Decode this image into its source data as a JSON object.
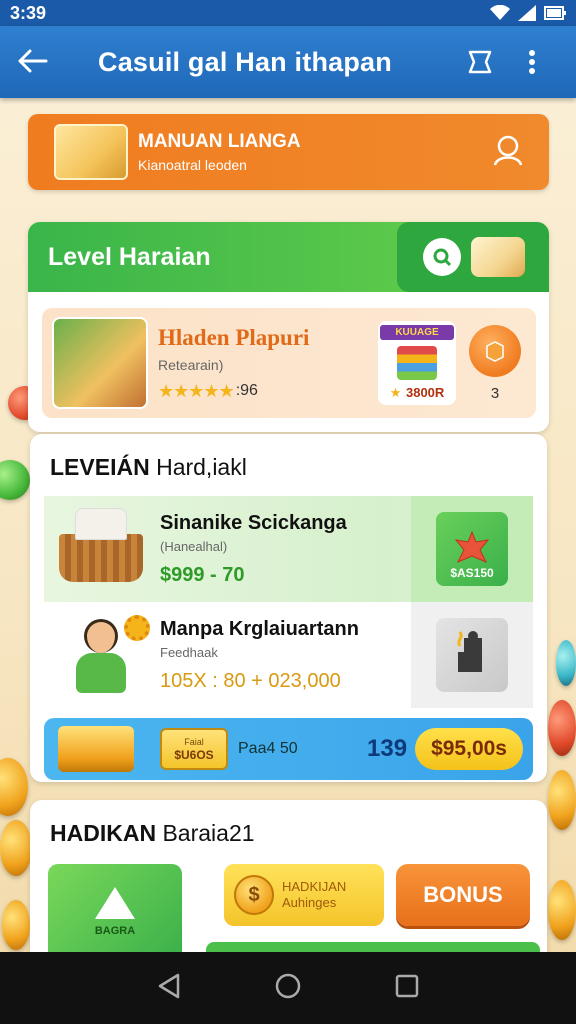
{
  "status": {
    "time": "3:39"
  },
  "appbar": {
    "title": "Casuil gal Han ithapan"
  },
  "banner": {
    "title": "MANUAN LIANGA",
    "subtitle": "Kianoatral leoden"
  },
  "level_card": {
    "header": "Level Haraian",
    "feature": {
      "title": "Hladen Plapuri",
      "subtitle": "Retearain)",
      "rating_text": ":96",
      "product_label": "KUUAGE",
      "product_value": "3800R",
      "side_number": "3"
    }
  },
  "list_card": {
    "title_bold": "LEVEIÁN",
    "title_rest": "Hard,iakl",
    "items": [
      {
        "title": "Sinanike Scickanga",
        "subtitle": "(Hanealhal)",
        "value": "$999 - 70",
        "badge": "$AS150"
      },
      {
        "title": "Manpa Krglaiuartann",
        "subtitle": "Feedhaak",
        "value": "105X : 80 + 023,000"
      }
    ],
    "promo": {
      "tag_top": "Faial",
      "tag_bottom": "$U6OS",
      "label": "Paa4 50",
      "count": "139",
      "price": "$95,00s"
    }
  },
  "bonus_card": {
    "title_bold": "HADIKAN",
    "title_rest": "Baraia21",
    "tile_label": "BAGRA",
    "reward_line1": "HADKIJAN",
    "reward_line2": "Auhinges",
    "bonus_label": "BONUS"
  },
  "colors": {
    "appbar": "#2068b8",
    "banner": "#f07c20",
    "level_header": "#3ab54a",
    "promo_bar": "#3aa4ea",
    "bonus_button": "#e8701a"
  }
}
